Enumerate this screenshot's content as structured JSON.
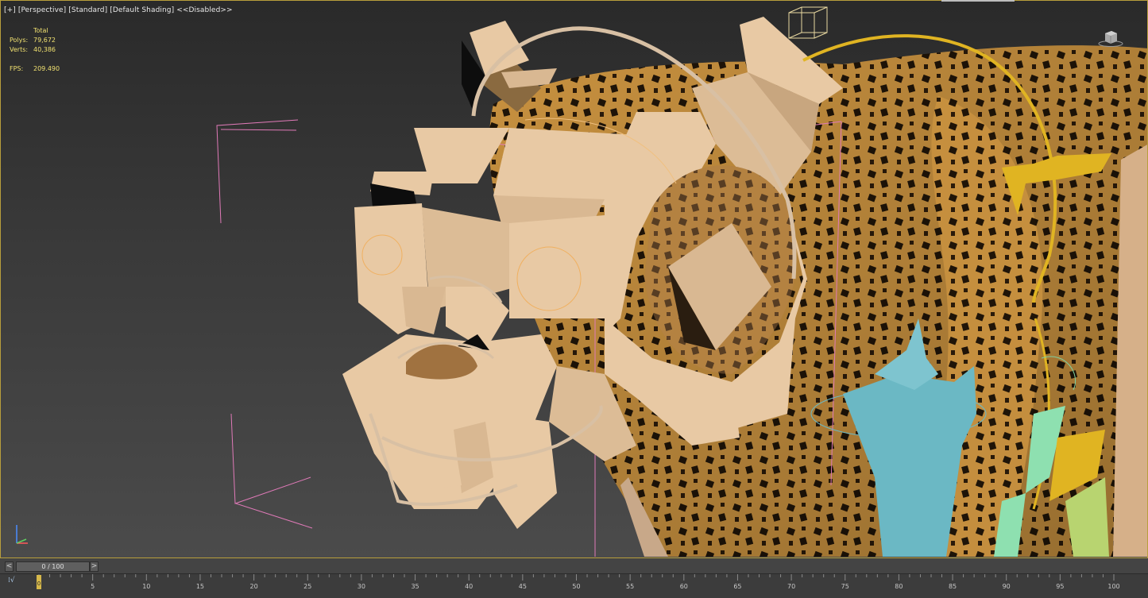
{
  "viewport": {
    "label_plus": "[+]",
    "label_view": "[Perspective]",
    "label_mode": "[Standard]",
    "label_shading": "[Default Shading]",
    "label_disabled": "<<Disabled>>"
  },
  "stats": {
    "header": "Total",
    "polys_label": "Polys:",
    "polys_value": "79,672",
    "verts_label": "Verts:",
    "verts_value": "40,386",
    "fps_label": "FPS:",
    "fps_value": "209.490"
  },
  "time_slider": {
    "prev": "<",
    "next": ">",
    "value": "0 / 100"
  },
  "trackbar": {
    "mini_curve": "⁞√",
    "current_frame": "0",
    "ticks": [
      "5",
      "10",
      "15",
      "20",
      "25",
      "30",
      "35",
      "40",
      "45",
      "50",
      "55",
      "60",
      "65",
      "70",
      "75",
      "80",
      "85",
      "90",
      "95",
      "100"
    ]
  },
  "colors": {
    "viewport_border": "#b89e3c",
    "bone": "#e8c9a4",
    "leopard": "#c48a3a",
    "control_yellow": "#e0b422",
    "control_cyan": "#6bb8c4",
    "frame_pink": "#e07ab8"
  },
  "icons": {
    "viewcube": "viewcube-icon",
    "axis_tripod": "axis-tripod-icon",
    "helper_box": "helper-box-icon"
  }
}
